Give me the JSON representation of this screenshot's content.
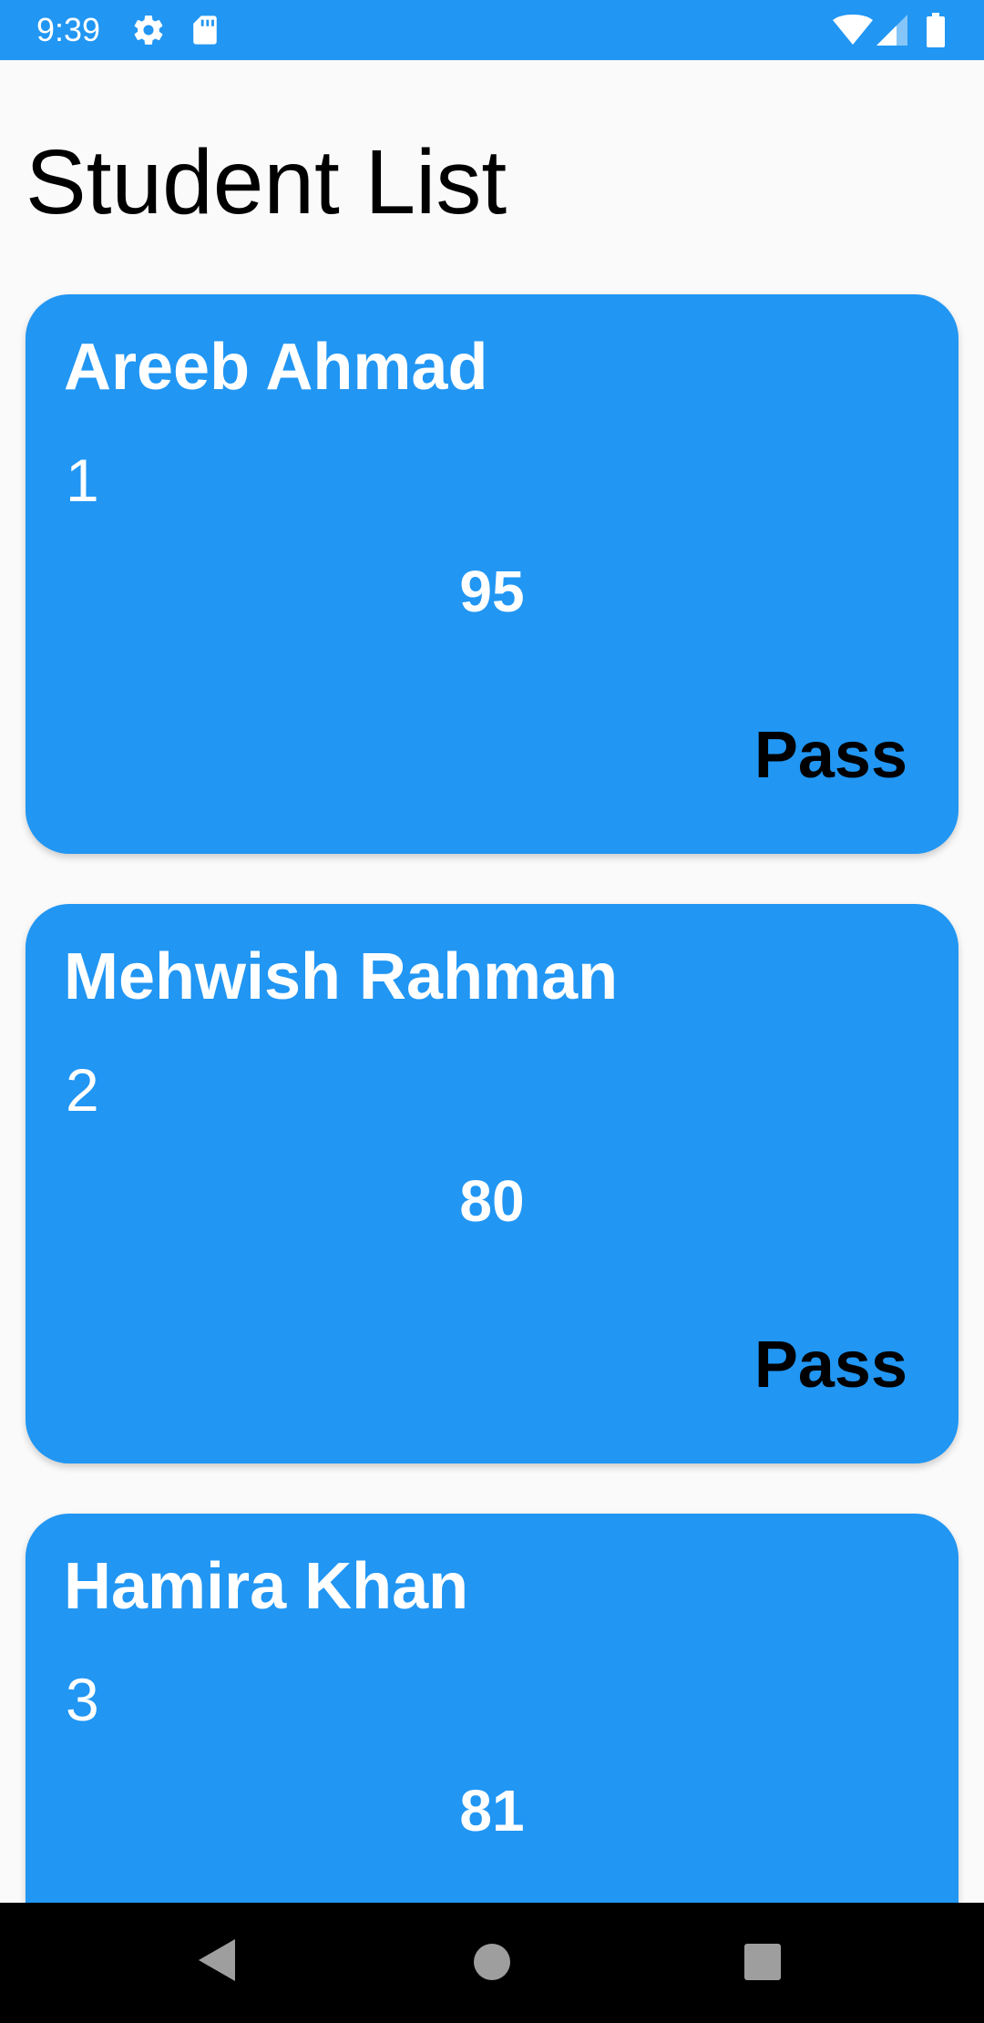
{
  "status_bar": {
    "time": "9:39",
    "icons": [
      "gear-icon",
      "sd-card-icon",
      "wifi-icon",
      "signal-icon",
      "battery-icon"
    ],
    "color": "#2196f3"
  },
  "page": {
    "title": "Student List"
  },
  "students": [
    {
      "name": "Areeb Ahmad",
      "id": "1",
      "score": "95",
      "result": "Pass"
    },
    {
      "name": "Mehwish Rahman",
      "id": "2",
      "score": "80",
      "result": "Pass"
    },
    {
      "name": "Hamira Khan",
      "id": "3",
      "score": "81",
      "result": ""
    }
  ],
  "theme": {
    "card_color": "#2196f3",
    "background": "#fafafa",
    "nav_bar": "#000000"
  },
  "nav_bar": {
    "icons": [
      "back-icon",
      "home-icon",
      "recents-icon"
    ]
  }
}
